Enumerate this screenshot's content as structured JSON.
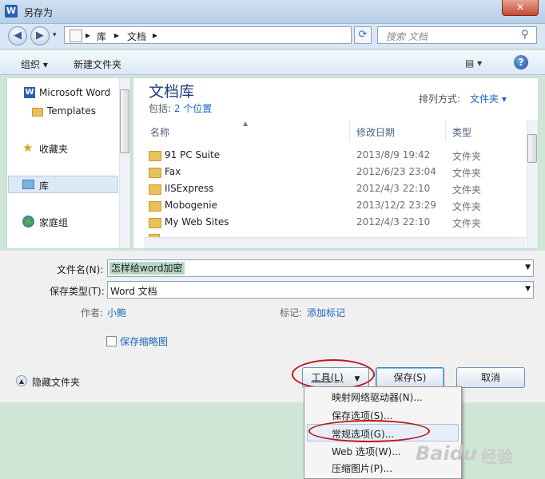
{
  "window": {
    "title": "另存为",
    "app_badge": "W",
    "close_glyph": "✕"
  },
  "addressbar": {
    "back_glyph": "◀",
    "forward_glyph": "▶",
    "crumbs": [
      "▸",
      "库",
      "▸",
      "文档",
      "▸"
    ],
    "search_placeholder": "搜索 文档"
  },
  "toolbar": {
    "organize": "组织 ▾",
    "new_folder": "新建文件夹",
    "view_icon": "▤ ▾",
    "help": "?"
  },
  "nav": {
    "items": [
      {
        "label": "Microsoft Word",
        "icon": "word-icon"
      },
      {
        "label": "Templates",
        "icon": "folder-icon"
      },
      {
        "label": "收藏夹",
        "icon": "star-icon"
      },
      {
        "label": "库",
        "icon": "library-icon"
      },
      {
        "label": "家庭组",
        "icon": "homegroup-icon"
      }
    ]
  },
  "library": {
    "title": "文档库",
    "includes_prefix": "包括: ",
    "includes_link": "2 个位置",
    "arrange_label": "排列方式:",
    "arrange_value": "文件夹 ▾"
  },
  "columns": {
    "name": "名称",
    "date": "修改日期",
    "type": "类型"
  },
  "files": [
    {
      "name": "91 PC Suite",
      "date": "2013/8/9 19:42",
      "type": "文件夹"
    },
    {
      "name": "Fax",
      "date": "2012/6/23 23:04",
      "type": "文件夹"
    },
    {
      "name": "IISExpress",
      "date": "2012/4/3 22:10",
      "type": "文件夹"
    },
    {
      "name": "Mobogenie",
      "date": "2013/12/2 23:29",
      "type": "文件夹"
    },
    {
      "name": "My Web Sites",
      "date": "2012/4/3 22:10",
      "type": "文件夹"
    }
  ],
  "form": {
    "filename_label": "文件名(N):",
    "filename_value": "怎样给word加密",
    "filetype_label": "保存类型(T):",
    "filetype_value": "Word 文档",
    "author_label": "作者:",
    "author_value": "小鲍",
    "tags_label": "标记:",
    "tags_value": "添加标记",
    "thumbnail_label": "保存缩略图"
  },
  "buttons": {
    "hide_folders": "隐藏文件夹",
    "tools": "工具(L)",
    "tools_arrow": "▼",
    "save": "保存(S)",
    "cancel": "取消"
  },
  "menu": {
    "items": [
      "映射网络驱动器(N)...",
      "保存选项(S)...",
      "常规选项(G)...",
      "Web 选项(W)...",
      "压缩图片(P)..."
    ]
  },
  "watermark": {
    "brand": "Baidu",
    "suffix": "经验"
  }
}
